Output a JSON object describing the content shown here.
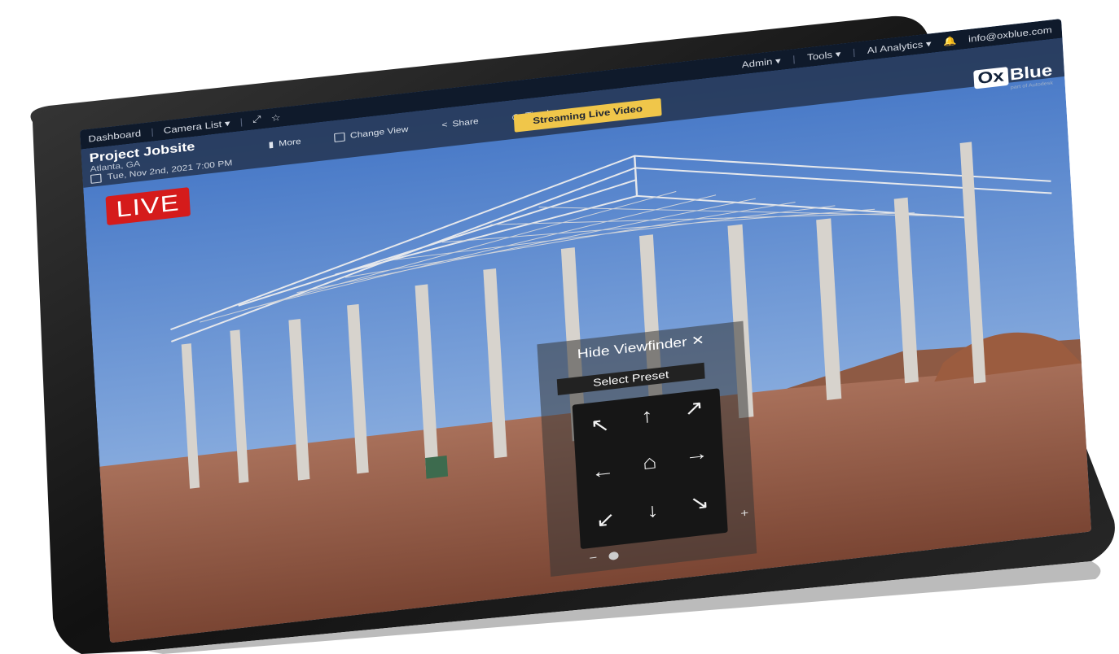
{
  "nav": {
    "dashboard": "Dashboard",
    "camera_list": "Camera List ▾",
    "admin": "Admin ▾",
    "tools": "Tools ▾",
    "ai_analytics": "AI Analytics ▾",
    "user_email": "info@oxblue.com"
  },
  "project": {
    "title": "Project Jobsite",
    "location": "Atlanta, GA",
    "datetime": "Tue, Nov 2nd, 2021 7:00 PM"
  },
  "actions": {
    "more": "More",
    "change_view": "Change View",
    "share": "Share",
    "timelapses": "Timelapses"
  },
  "streaming_label": "Streaming Live Video",
  "logo": {
    "ox": "Ox",
    "blue": "Blue",
    "sub": "part of Autodesk"
  },
  "live_label": "LIVE",
  "viewfinder": {
    "hide_label": "Hide Viewfinder ✕",
    "preset_label": "Select Preset",
    "zoom_minus": "−",
    "zoom_plus": "+"
  },
  "icons": {
    "arrows": [
      "arrow-up-left-icon",
      "arrow-up-icon",
      "arrow-up-right-icon",
      "arrow-left-icon",
      "home-icon",
      "arrow-right-icon",
      "arrow-down-left-icon",
      "arrow-down-icon",
      "arrow-down-right-icon"
    ]
  },
  "colors": {
    "live_red": "#d51b1b",
    "stream_yellow": "#f0c64a",
    "header_navy": "#0f1a2b",
    "subbar_blue": "#263754"
  }
}
